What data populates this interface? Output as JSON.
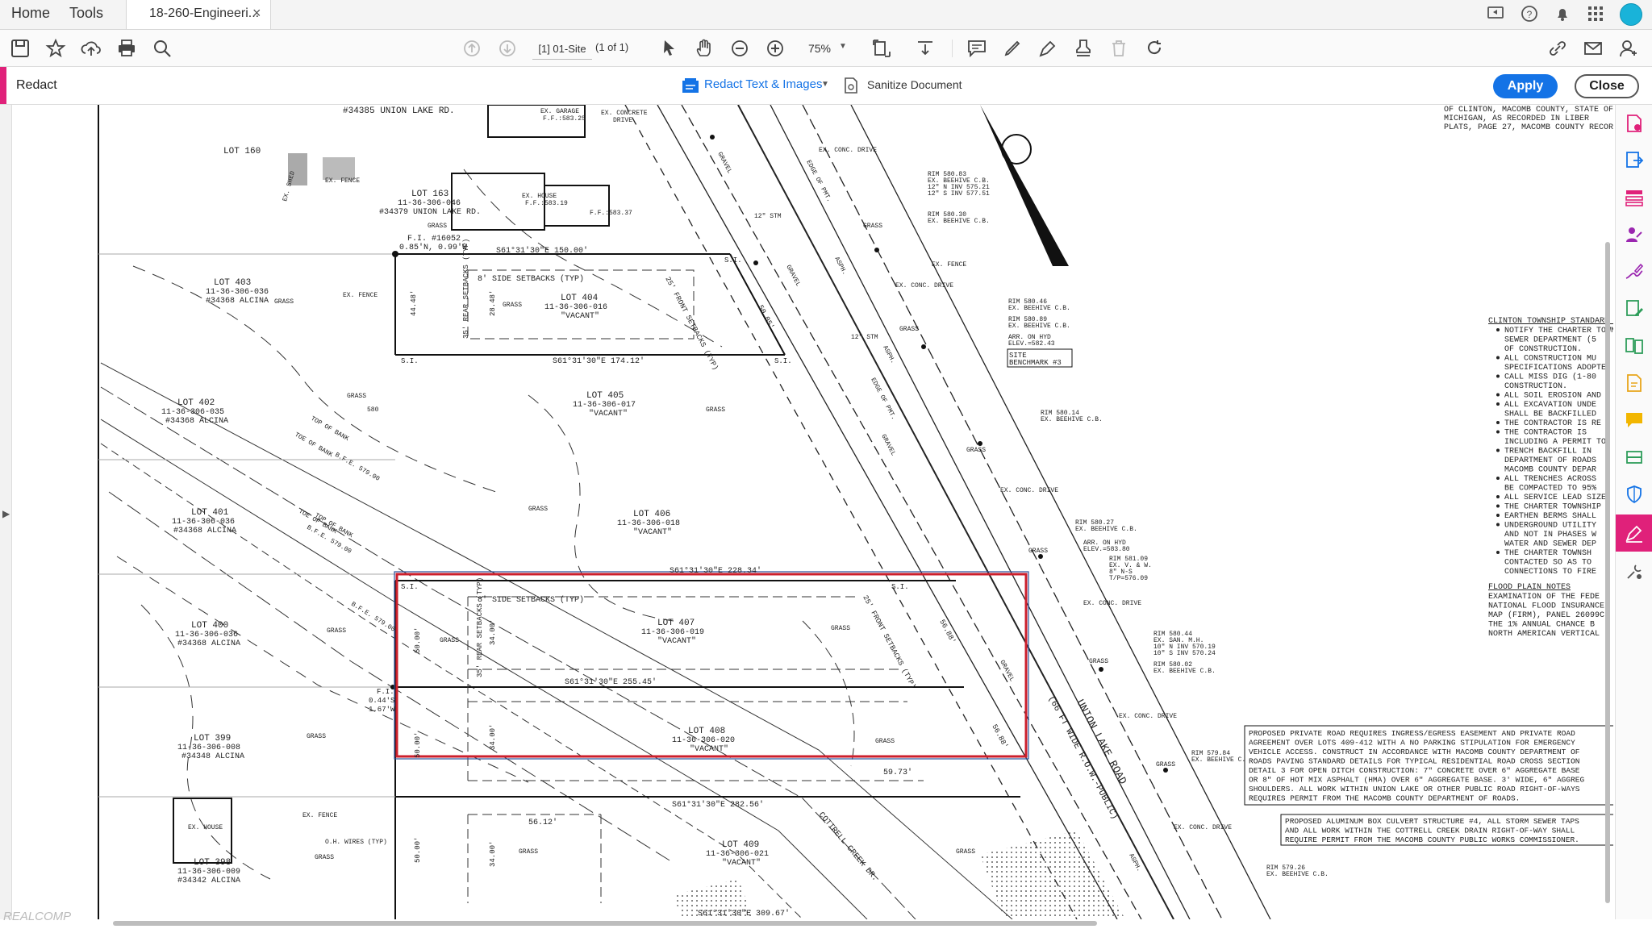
{
  "tabbar": {
    "menu_home": "Home",
    "menu_tools": "Tools",
    "tab_title": "18-260-Engineeri...",
    "tab_close": "×"
  },
  "toolbar": {
    "page_value": "[1] 01-Site",
    "page_count": "(1 of 1)",
    "zoom_value": "75%"
  },
  "redact": {
    "title": "Redact",
    "text_images_label": "Redact Text & Images",
    "sanitize_label": "Sanitize Document",
    "apply_label": "Apply",
    "close_label": "Close"
  },
  "colors": {
    "accent": "#e0217a",
    "primary": "#1473e6",
    "redaction_box": "#cc1f2c"
  },
  "watermark": "REALCOMP",
  "drawing": {
    "top_address": "#34385 UNION LAKE RD.",
    "ex_garage": "EX. GARAGE",
    "ex_garage_ff": "F.F.:583.25",
    "ex_concrete_drive": "EX. CONCRETE",
    "drive": "DRIVE",
    "lot160": "LOT 160",
    "lot163": "LOT 163",
    "lot163_id": "11-36-306-046",
    "lot163_addr": "#34379 UNION LAKE RD.",
    "ex_house": "EX. HOUSE",
    "ex_house_ff": "F.F.:583.19",
    "ex_garage2_ff": "F.F.:583.37",
    "ex_shed": "EX. SHED",
    "ex_fence": "EX. FENCE",
    "grass": "GRASS",
    "fi1": "F.I. #16052",
    "fi1b": "0.85'N, 0.99'W",
    "b1": "S61°31'30\"E 150.00'",
    "lot403": "LOT 403",
    "lot403_id": "11-36-306-036",
    "lot403_addr": "#34368 ALCINA",
    "side_setbacks": "8' SIDE SETBACKS (TYP)",
    "lot404": "LOT 404",
    "lot404_id": "11-36-306-016",
    "vacant": "\"VACANT\"",
    "front_setbacks": "25' FRONT SETBACKS (TYP)",
    "rear_setbacks": "35' REAR SETBACKS (TYP)",
    "d4448": "44.48'",
    "d2848": "28.48'",
    "d5005": "50.05'",
    "b2": "S61°31'30\"E 174.12'",
    "si": "S.I.",
    "lot405": "LOT 405",
    "lot405_id": "11-36-306-017",
    "lot402": "LOT 402",
    "lot402_id": "11-36-306-035",
    "lot402_addr": "#34368 ALCINA",
    "top_of_bank": "TOP OF BANK",
    "toe_of_bank": "TOE OF BANK",
    "bfe579": "B.F.E. 579.00",
    "d580": "580",
    "lot406": "LOT 406",
    "lot406_id": "11-36-306-018",
    "lot401": "LOT 401",
    "lot401_id": "11-36-306-036",
    "lot401_addr": "#34368 ALCINA",
    "b3": "S61°31'30\"E 228.34'",
    "lot400": "LOT 400",
    "lot400_id": "11-36-306-036",
    "lot400_addr": "#34368 ALCINA",
    "lot407": "LOT 407",
    "lot407_id": "11-36-306-019",
    "d5000": "50.00'",
    "d3400": "34.00'",
    "fi2": "F.I.",
    "fi2b": "0.44'S",
    "fi2c": "1.67'W",
    "b4": "S61°31'30\"E 255.45'",
    "lot408": "LOT 408",
    "lot408_id": "11-36-306-020",
    "d5973": "59.73'",
    "d5688": "56.88'",
    "lot399": "LOT 399",
    "lot399_id": "11-36-306-008",
    "lot399_addr": "#34348 ALCINA",
    "b5": "S61°31'30\"E 282.56'",
    "d5612": "56.12'",
    "ex_house2": "EX. HOUSE",
    "oh_wires": "O.H. WIRES (TYP)",
    "lot398": "LOT 398",
    "lot398_id": "11-36-306-009",
    "lot398_addr": "#34342 ALCINA",
    "lot409": "LOT 409",
    "lot409_id": "11-36-306-021",
    "cottrell": "COTTRELL CREEK DR.",
    "b6": "S61°31'30\"E 309.67'",
    "union_lake_road": "UNION LAKE ROAD",
    "row": "(66 FT WIDE R.O.W.-PUBLIC)",
    "edge_of_pmt": "EDGE OF PMT.",
    "asph": "ASPH.",
    "gravel": "GRAVEL",
    "ex_conc_drive": "EX. CONC. DRIVE",
    "stm12": "12\" STM",
    "rim1": "RIM 580.83",
    "rim1b": "EX. BEEHIVE C.B.",
    "rim1c": "12\" N INV 575.21",
    "rim1d": "12\" S INV 577.51",
    "rim2": "RIM 580.30",
    "rim3": "RIM 580.46",
    "rim4": "RIM 580.89",
    "arr_hyd": "ARR. ON HYD",
    "elev1": "ELEV.=582.43",
    "site_bm": "SITE",
    "site_bm2": "BENCHMARK #3",
    "rim5": "RIM 580.14",
    "rim6": "RIM 580.27",
    "elev2": "ELEV.=583.80",
    "rim7": "RIM 581.09",
    "rim7b": "EX. V. & W.",
    "rim7c": "8\" N-S",
    "rim7d": "T/P=576.09",
    "rim8": "RIM 580.44",
    "rim8b": "EX. SAN. M.H.",
    "rim8c": "10\" N INV 570.19",
    "rim8d": "10\" S INV 570.24",
    "rim9": "RIM 580.02",
    "rim10": "RIM 579.84",
    "rim11": "RIM 579.26",
    "ex_beehive": "EX. BEEHIVE C.B.",
    "legal1": "OF CLINTON, MACOMB COUNTY, STATE OF",
    "legal2": "MICHIGAN, AS RECORDED IN LIBER",
    "legal3": "PLATS, PAGE 27, MACOMB COUNTY RECORDS",
    "std_title": "CLINTON TOWNSHIP STANDARD NOTES",
    "std_notes": [
      "NOTIFY THE CHARTER TOWNSHIP",
      "SEWER DEPARTMENT (5",
      "OF CONSTRUCTION.",
      "ALL CONSTRUCTION MU",
      "SPECIFICATIONS ADOPTE",
      "CALL MISS DIG (1-80",
      "CONSTRUCTION.",
      "ALL SOIL EROSION AND",
      "ALL EXCAVATION UNDE",
      "SHALL BE BACKFILLED",
      "THE CONTRACTOR IS RE",
      "THE CONTRACTOR IS",
      "INCLUDING A PERMIT TO",
      "TRENCH BACKFILL IN",
      "DEPARTMENT OF ROADS",
      "MACOMB COUNTY DEPAR",
      "ALL TRENCHES ACROSS",
      "BE COMPACTED TO 95%",
      "ALL SERVICE LEAD SIZE",
      "THE CHARTER TOWNSHIP",
      "EARTHEN BERMS SHALL",
      "UNDERGROUND UTILITY",
      "AND NOT IN PHASES W",
      "WATER AND SEWER DEP",
      "THE CHARTER TOWNSH",
      "CONTACTED SO AS TO",
      "CONNECTIONS TO FIRE"
    ],
    "flood_title": "FLOOD PLAIN NOTES",
    "flood_notes": [
      "EXAMINATION OF THE FEDE",
      "NATIONAL FLOOD INSURANCE",
      "MAP (FIRM), PANEL 26099C",
      "THE 1% ANNUAL CHANCE B",
      "NORTH AMERICAN VERTICAL"
    ],
    "private_road_notes": [
      "PROPOSED PRIVATE ROAD REQUIRES INGRESS/EGRESS EASEMENT AND PRIVATE ROAD",
      "AGREEMENT OVER LOTS 409-412 WITH A NO PARKING STIPULATION FOR EMERGENCY",
      "VEHICLE ACCESS. CONSTRUCT IN ACCORDANCE WITH MACOMB COUNTY DEPARTMENT OF",
      "ROADS PAVING STANDARD DETAILS FOR TYPICAL RESIDENTIAL ROAD CROSS SECTION",
      "DETAIL 3 FOR OPEN DITCH CONSTRUCTION: 7\" CONCRETE OVER 6\" AGGREGATE BASE",
      "OR 8\" OF HOT MIX ASPHALT (HMA) OVER 6\" AGGREGATE BASE. 3' WIDE, 6\" AGGREG",
      "SHOULDERS. ALL WORK WITHIN UNION LAKE OR OTHER PUBLIC ROAD RIGHT-OF-WAYS",
      "REQUIRES PERMIT FROM THE MACOMB COUNTY DEPARTMENT OF ROADS."
    ],
    "culvert_notes": [
      "PROPOSED ALUMINUM BOX CULVERT STRUCTURE #4, ALL STORM SEWER TAPS",
      "AND ALL WORK WITHIN THE COTTRELL CREEK DRAIN RIGHT-OF-WAY SHALL",
      "REQUIRE PERMIT FROM THE MACOMB COUNTY PUBLIC WORKS COMMISSIONER."
    ]
  }
}
